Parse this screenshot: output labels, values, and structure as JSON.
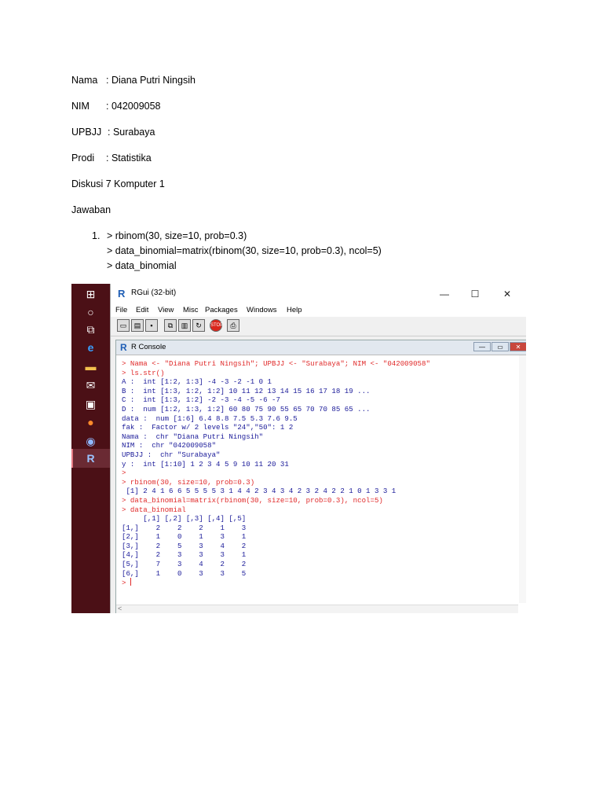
{
  "doc": {
    "fields": [
      {
        "label": "Nama",
        "value": ": Diana Putri Ningsih"
      },
      {
        "label": "NIM",
        "value": ": 042009058"
      },
      {
        "label": "UPBJJ",
        "value": ": Surabaya"
      },
      {
        "label": "Prodi",
        "value": ": Statistika"
      }
    ],
    "heading": "Diskusi 7 Komputer 1",
    "answer_label": "Jawaban",
    "item_number": "1.",
    "commands": [
      "> rbinom(30, size=10, prob=0.3)",
      "> data_binomial=matrix(rbinom(30, size=10, prob=0.3), ncol=5)",
      "> data_binomial"
    ]
  },
  "taskbar": {
    "icons": [
      "windows-start",
      "search",
      "task-view",
      "internet-explorer",
      "file-explorer",
      "mail",
      "store",
      "firefox",
      "chrome",
      "r-app"
    ]
  },
  "rgui": {
    "title": "RGui (32-bit)",
    "window_controls": [
      "—",
      "☐",
      "✕"
    ],
    "menu": [
      "File",
      "Edit",
      "View",
      "Misc",
      "Packages",
      "Windows",
      "Help"
    ],
    "console_title": "R Console",
    "lines": [
      {
        "c": "red",
        "t": "> Nama <- \"Diana Putri Ningsih\"; UPBJJ <- \"Surabaya\"; NIM <- \"042009058\""
      },
      {
        "c": "red",
        "t": "> ls.str()"
      },
      {
        "c": "blue",
        "t": "A :  int [1:2, 1:3] -4 -3 -2 -1 0 1"
      },
      {
        "c": "blue",
        "t": "B :  int [1:3, 1:2, 1:2] 10 11 12 13 14 15 16 17 18 19 ..."
      },
      {
        "c": "blue",
        "t": "C :  int [1:3, 1:2] -2 -3 -4 -5 -6 -7"
      },
      {
        "c": "blue",
        "t": "D :  num [1:2, 1:3, 1:2] 60 80 75 90 55 65 70 70 85 65 ..."
      },
      {
        "c": "blue",
        "t": "data :  num [1:6] 6.4 8.8 7.5 5.3 7.6 9.5"
      },
      {
        "c": "blue",
        "t": "fak :  Factor w/ 2 levels \"24\",\"50\": 1 2"
      },
      {
        "c": "blue",
        "t": "Nama :  chr \"Diana Putri Ningsih\""
      },
      {
        "c": "blue",
        "t": "NIM :  chr \"042009058\""
      },
      {
        "c": "blue",
        "t": "UPBJJ :  chr \"Surabaya\""
      },
      {
        "c": "blue",
        "t": "y :  int [1:10] 1 2 3 4 5 9 10 11 20 31"
      },
      {
        "c": "red",
        "t": ">"
      },
      {
        "c": "red",
        "t": "> rbinom(30, size=10, prob=0.3)"
      },
      {
        "c": "blue",
        "t": " [1] 2 4 1 6 6 5 5 5 5 3 1 4 4 2 3 4 3 4 2 3 2 4 2 2 1 0 1 3 3 1"
      },
      {
        "c": "red",
        "t": "> data_binomial=matrix(rbinom(30, size=10, prob=0.3), ncol=5)"
      },
      {
        "c": "red",
        "t": "> data_binomial"
      },
      {
        "c": "blue",
        "t": "     [,1] [,2] [,3] [,4] [,5]"
      },
      {
        "c": "blue",
        "t": "[1,]    2    2    2    1    3"
      },
      {
        "c": "blue",
        "t": "[2,]    1    0    1    3    1"
      },
      {
        "c": "blue",
        "t": "[3,]    2    5    3    4    2"
      },
      {
        "c": "blue",
        "t": "[4,]    2    3    3    3    1"
      },
      {
        "c": "blue",
        "t": "[5,]    7    3    4    2    2"
      },
      {
        "c": "blue",
        "t": "[6,]    1    0    3    3    5"
      }
    ],
    "prompt": "> "
  }
}
